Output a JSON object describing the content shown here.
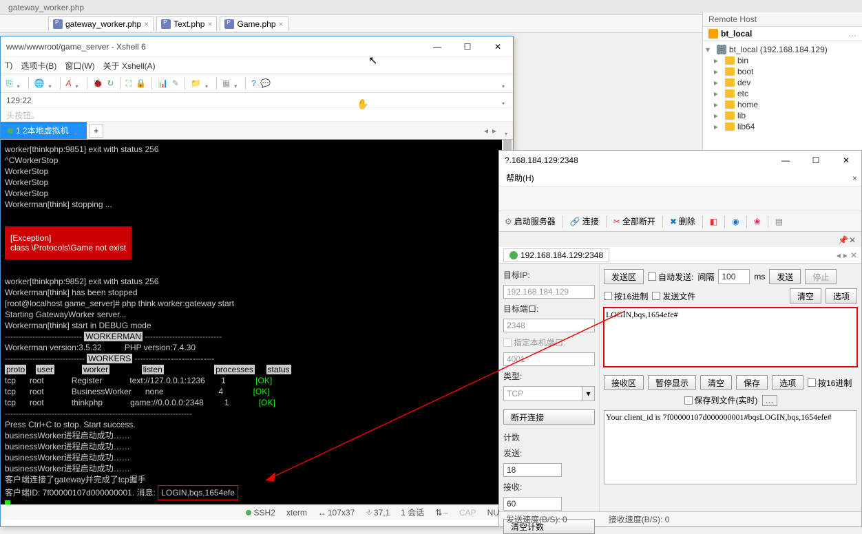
{
  "ide": {
    "top_tab": "gateway_worker.php",
    "tabs": [
      {
        "label": "gateway_worker.php"
      },
      {
        "label": "Text.php"
      },
      {
        "label": "Game.php"
      }
    ]
  },
  "xshell": {
    "title": "www/wwwroot/game_server - Xshell 6",
    "menu": [
      "T)",
      "选项卡(B)",
      "窗口(W)",
      "关于 Xshell(A)"
    ],
    "addr": "129:22",
    "hint": "头按钮。",
    "tab_active": "1 2本地虚拟机",
    "terminal_lines": [
      "",
      "worker[thinkphp:9851] exit with status 256",
      "^CWorkerStop",
      "WorkerStop",
      "WorkerStop",
      "WorkerStop",
      "Workerman[think] stopping ..."
    ],
    "exception_lines": [
      "[Exception]",
      "class \\Protocols\\Game not exist"
    ],
    "terminal_lines2": [
      "",
      "worker[thinkphp:9852] exit with status 256",
      "Workerman[think] has been stopped",
      "[root@localhost game_server]# php think worker:gateway start",
      "Starting GatewayWorker server...",
      "Workerman[think] start in DEBUG mode"
    ],
    "banner1": "WORKERMAN",
    "version_line": "Workerman version:3.5.32          PHP version:7.4.30",
    "banner2": "WORKERS",
    "table": {
      "headers": [
        "proto",
        "user",
        "worker",
        "listen",
        "processes",
        "status"
      ],
      "rows": [
        [
          "tcp",
          "root",
          "Register",
          "text://127.0.0.1:1236",
          "1",
          "[OK]"
        ],
        [
          "tcp",
          "root",
          "BusinessWorker",
          "none",
          "4",
          "[OK]"
        ],
        [
          "tcp",
          "root",
          "thinkphp",
          "game://0.0.0.0:2348",
          "1",
          "[OK]"
        ]
      ]
    },
    "terminal_lines3": [
      "Press Ctrl+C to stop. Start success.",
      "businessWorker进程启动成功……",
      "businessWorker进程启动成功……",
      "businessWorker进程启动成功……",
      "businessWorker进程启动成功……",
      "客户端连接了gateway并完成了tcp握手"
    ],
    "client_line_prefix": "客户端ID: 7f00000107d000000001. 消息: ",
    "client_msg": "LOGIN,bqs,1654efe",
    "status": {
      "conn": "SSH2",
      "term": "xterm",
      "size": "107x37",
      "pos": "37,1",
      "sess": "1 会话",
      "caps": "CAP",
      "num": "NUM"
    }
  },
  "remote": {
    "title": "Remote Host",
    "header": "bt_local",
    "root": "bt_local (192.168.184.129)",
    "folders": [
      "bin",
      "boot",
      "dev",
      "etc",
      "home",
      "lib",
      "lib64"
    ]
  },
  "sock": {
    "title_addr": "?.168.184.129:2348",
    "menu": [
      "帮助(H)"
    ],
    "tools": {
      "start_server": "启动服务器",
      "connect": "连接",
      "disconnect_all": "全部断开",
      "delete": "删除"
    },
    "conn_tab": "192.168.184.129:2348",
    "left": {
      "target_ip_label": "目标IP:",
      "target_ip": "192.168.184.129",
      "target_port_label": "目标端口:",
      "target_port": "2348",
      "local_port_label": "指定本机端口:",
      "local_port": "4001",
      "type_label": "类型:",
      "type": "TCP",
      "disconnect": "断开连接",
      "count_label": "计数",
      "send_label": "发送:",
      "send_count": "18",
      "recv_label": "接收:",
      "recv_count": "60",
      "clear_count": "清空计数"
    },
    "right": {
      "send_area_label": "发送区",
      "auto_send_label": "自动发送:",
      "interval_label": "间隔",
      "interval": "100",
      "ms": "ms",
      "send_btn": "发送",
      "stop_btn": "停止",
      "hex_send_label": "按16进制",
      "send_file_label": "发送文件",
      "clear": "清空",
      "options": "选项",
      "send_text": "LOGIN,bqs,1654efe#",
      "recv_area_label": "接收区",
      "pause": "暂停显示",
      "save": "保存",
      "hex_recv_label": "按16进制",
      "save_to_file_label": "保存到文件(实时)",
      "recv_text": "Your client_id is 7f00000107d000000001#bqsLOGIN,bqs,1654efe#"
    },
    "status": {
      "send_rate": "发送速度(B/S): 0",
      "recv_rate": "接收速度(B/S): 0"
    }
  }
}
